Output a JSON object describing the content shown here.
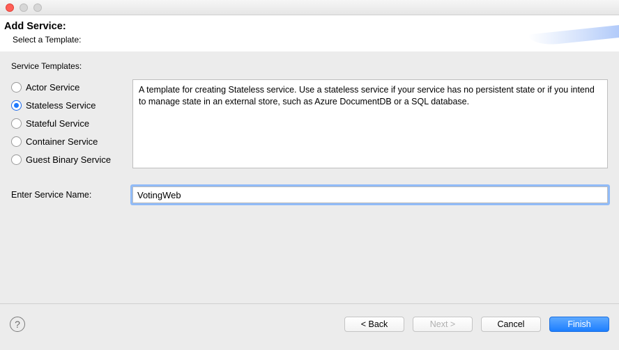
{
  "header": {
    "title": "Add Service:",
    "subtitle": "Select a Template:"
  },
  "group_label": "Service Templates:",
  "templates": [
    {
      "label": "Actor Service",
      "selected": false
    },
    {
      "label": "Stateless Service",
      "selected": true
    },
    {
      "label": "Stateful Service",
      "selected": false
    },
    {
      "label": "Container Service",
      "selected": false
    },
    {
      "label": "Guest Binary Service",
      "selected": false
    }
  ],
  "description": "A template for creating Stateless service.  Use a stateless service if your service has no persistent state or if you intend to manage state in an external store, such as Azure DocumentDB or a SQL database.",
  "service_name": {
    "label": "Enter Service Name:",
    "value": "VotingWeb"
  },
  "buttons": {
    "back": "< Back",
    "next": "Next >",
    "cancel": "Cancel",
    "finish": "Finish"
  },
  "help_glyph": "?"
}
